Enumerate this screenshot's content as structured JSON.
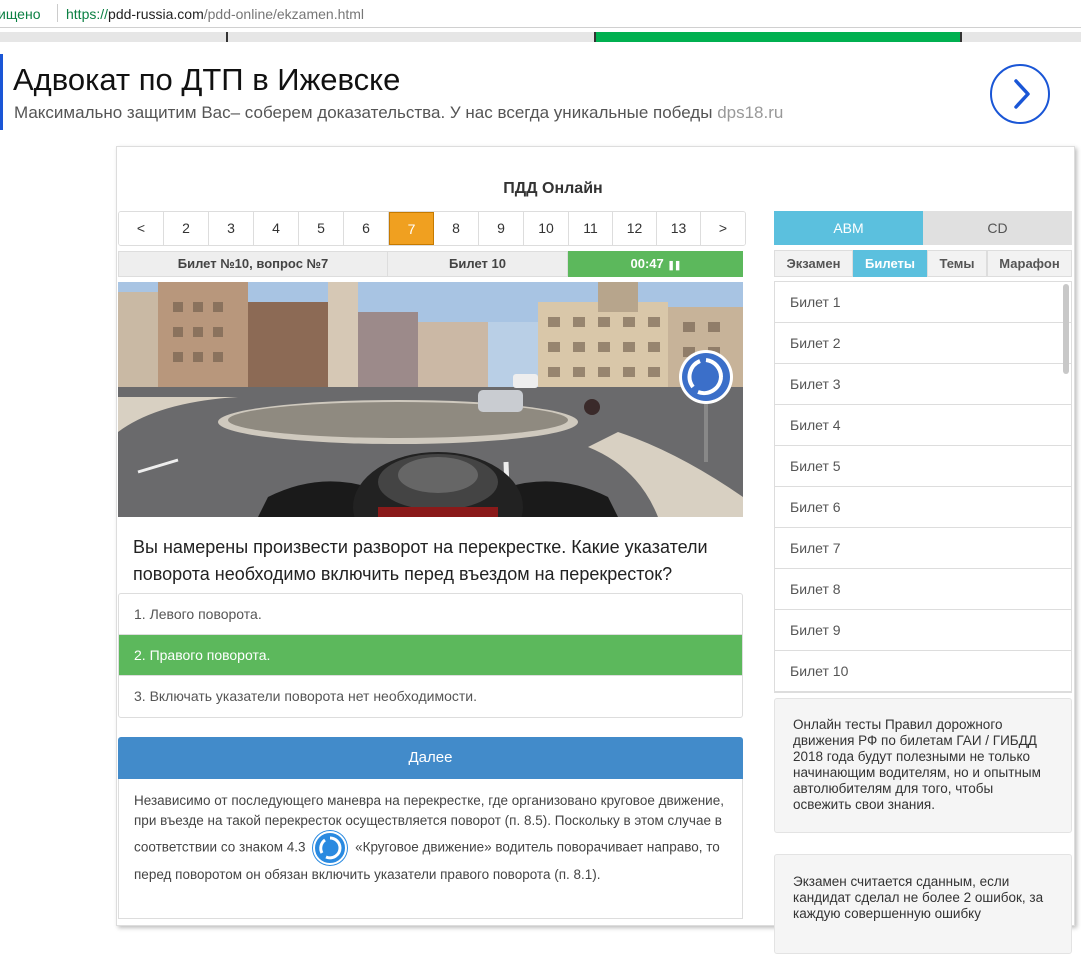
{
  "browser": {
    "secure_label": "ищено",
    "url_scheme": "https://",
    "url_host": "pdd-russia.com",
    "url_path": "/pdd-online/ekzamen.html"
  },
  "progress": {
    "fill_start_fraction": 0.55,
    "fill_end_fraction": 0.89
  },
  "ad": {
    "title": "Адвокат по ДТП в Ижевске",
    "description": "Максимально защитим Вас– соберем доказательства. У нас всегда уникальные победы",
    "domain": "dps18.ru",
    "arrow_icon": "chevron-right-icon"
  },
  "panel": {
    "title": "ПДД Онлайн",
    "pager": [
      {
        "label": "<"
      },
      {
        "label": "2"
      },
      {
        "label": "3"
      },
      {
        "label": "4"
      },
      {
        "label": "5"
      },
      {
        "label": "6"
      },
      {
        "label": "7"
      },
      {
        "label": "8"
      },
      {
        "label": "9"
      },
      {
        "label": "10"
      },
      {
        "label": "11"
      },
      {
        "label": "12"
      },
      {
        "label": "13"
      },
      {
        "label": ">"
      }
    ],
    "active_page": "7",
    "info": {
      "ticket_question": "Билет №10, вопрос №7",
      "ticket": "Билет 10",
      "timer": "00:47"
    },
    "question": "Вы намерены произвести разворот на перекрестке. Какие указатели поворота необходимо включить перед въездом на перекресток?",
    "answers": [
      {
        "text": "1. Левого поворота."
      },
      {
        "text": "2. Правого поворота."
      },
      {
        "text": "3. Включать указатели поворота нет необходимости."
      }
    ],
    "correct_answer_index": 1,
    "next_label": "Далее",
    "explanation": {
      "part1": "Независимо от последующего маневра на перекрестке, где организовано круговое движение, при въезде на такой перекресток осуществляется поворот (п. 8.5). Поскольку в этом случае в соответствии со знаком 4.3",
      "part2": "«Круговое движение» водитель поворачивает направо, то перед поворотом он обязан включить указатели правого поворота (п. 8.1)."
    }
  },
  "sidebar": {
    "categories": {
      "abm": "ABM",
      "cd": "CD"
    },
    "modes": [
      {
        "label": "Экзамен"
      },
      {
        "label": "Билеты"
      },
      {
        "label": "Темы"
      },
      {
        "label": "Марафон"
      }
    ],
    "active_mode": "Билеты",
    "tickets": [
      {
        "label": "Билет 1"
      },
      {
        "label": "Билет 2"
      },
      {
        "label": "Билет 3"
      },
      {
        "label": "Билет 4"
      },
      {
        "label": "Билет 5"
      },
      {
        "label": "Билет 6"
      },
      {
        "label": "Билет 7"
      },
      {
        "label": "Билет 8"
      },
      {
        "label": "Билет 9"
      },
      {
        "label": "Билет 10"
      }
    ],
    "info1": "Онлайн тесты Правил дорожного движения РФ по билетам ГАИ / ГИБДД 2018 года будут полезными не только начинающим водителям, но и опытным автолюбителям для того, чтобы освежить свои знания.",
    "info2": "Экзамен считается сданным, если кандидат сделал не более 2 ошибок, за каждую совершенную ошибку"
  },
  "colors": {
    "accent_blue": "#428bca",
    "info_blue": "#5bc0de",
    "success_green": "#5cb85c",
    "active_orange": "#f0a020"
  }
}
